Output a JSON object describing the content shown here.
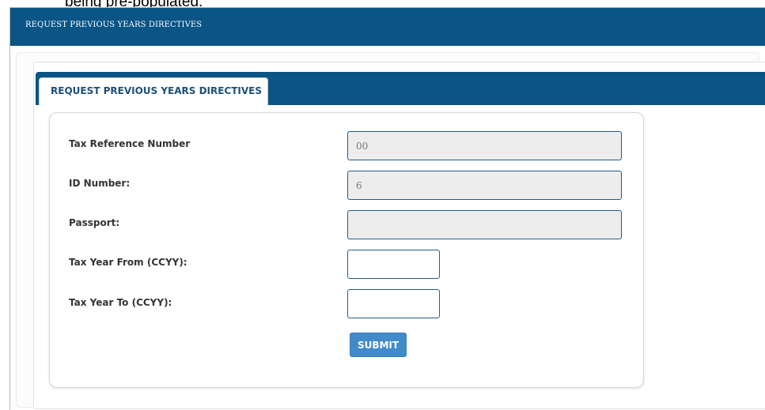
{
  "doc_caption": "being pre-populated.",
  "window": {
    "title": "REQUEST PREVIOUS YEARS DIRECTIVES"
  },
  "tabs": [
    {
      "label": "REQUEST PREVIOUS YEARS DIRECTIVES",
      "active": true
    }
  ],
  "form": {
    "fields": [
      {
        "label": "Tax Reference Number",
        "value": "00",
        "readonly": true
      },
      {
        "label": "ID Number:",
        "value": "6",
        "readonly": true
      },
      {
        "label": "Passport:",
        "value": "",
        "readonly": true
      },
      {
        "label": "Tax Year From (CCYY):",
        "value": "",
        "readonly": false
      },
      {
        "label": "Tax Year To (CCYY):",
        "value": "",
        "readonly": false
      }
    ],
    "submit_label": "SUBMIT"
  },
  "colors": {
    "header_bar": "#0a5486",
    "tab_text": "#1d4f79",
    "input_border": "#1f5f8b",
    "readonly_bg": "#ededed",
    "submit_bg": "#428bca"
  }
}
